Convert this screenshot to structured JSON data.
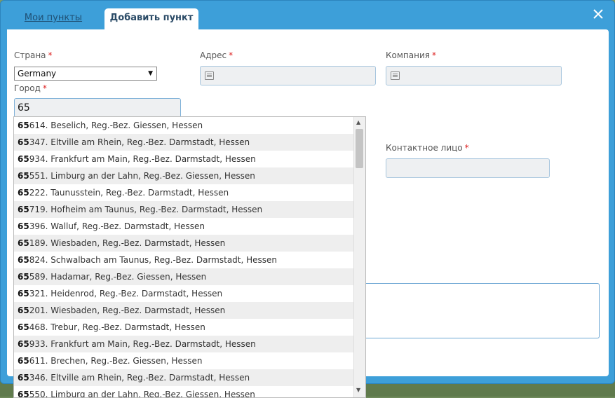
{
  "tabs": {
    "my_points": "Мои пункты",
    "add_point": "Добавить пункт"
  },
  "form": {
    "country_label": "Страна",
    "country_value": "Germany",
    "city_label": "Город",
    "city_value": "65",
    "address_label": "Адрес",
    "company_label": "Компания",
    "contact_label": "Контактное лицо",
    "required_mark": "*"
  },
  "suggestions": [
    {
      "prefix": "65",
      "rest": "614. Beselich, Reg.-Bez. Giessen, Hessen"
    },
    {
      "prefix": "65",
      "rest": "347. Eltville am Rhein, Reg.-Bez. Darmstadt, Hessen"
    },
    {
      "prefix": "65",
      "rest": "934. Frankfurt am Main, Reg.-Bez. Darmstadt, Hessen"
    },
    {
      "prefix": "65",
      "rest": "551. Limburg an der Lahn, Reg.-Bez. Giessen, Hessen"
    },
    {
      "prefix": "65",
      "rest": "222. Taunusstein, Reg.-Bez. Darmstadt, Hessen"
    },
    {
      "prefix": "65",
      "rest": "719. Hofheim am Taunus, Reg.-Bez. Darmstadt, Hessen"
    },
    {
      "prefix": "65",
      "rest": "396. Walluf, Reg.-Bez. Darmstadt, Hessen"
    },
    {
      "prefix": "65",
      "rest": "189. Wiesbaden, Reg.-Bez. Darmstadt, Hessen"
    },
    {
      "prefix": "65",
      "rest": "824. Schwalbach am Taunus, Reg.-Bez. Darmstadt, Hessen"
    },
    {
      "prefix": "65",
      "rest": "589. Hadamar, Reg.-Bez. Giessen, Hessen"
    },
    {
      "prefix": "65",
      "rest": "321. Heidenrod, Reg.-Bez. Darmstadt, Hessen"
    },
    {
      "prefix": "65",
      "rest": "201. Wiesbaden, Reg.-Bez. Darmstadt, Hessen"
    },
    {
      "prefix": "65",
      "rest": "468. Trebur, Reg.-Bez. Darmstadt, Hessen"
    },
    {
      "prefix": "65",
      "rest": "933. Frankfurt am Main, Reg.-Bez. Darmstadt, Hessen"
    },
    {
      "prefix": "65",
      "rest": "611. Brechen, Reg.-Bez. Giessen, Hessen"
    },
    {
      "prefix": "65",
      "rest": "346. Eltville am Rhein, Reg.-Bez. Darmstadt, Hessen"
    },
    {
      "prefix": "65",
      "rest": "550. Limburg an der Lahn, Reg.-Bez. Giessen, Hessen"
    }
  ],
  "icons": {
    "close": "close-icon",
    "field": "list-icon"
  },
  "colors": {
    "modal": "#3d9fd9",
    "required": "#dd2222"
  }
}
